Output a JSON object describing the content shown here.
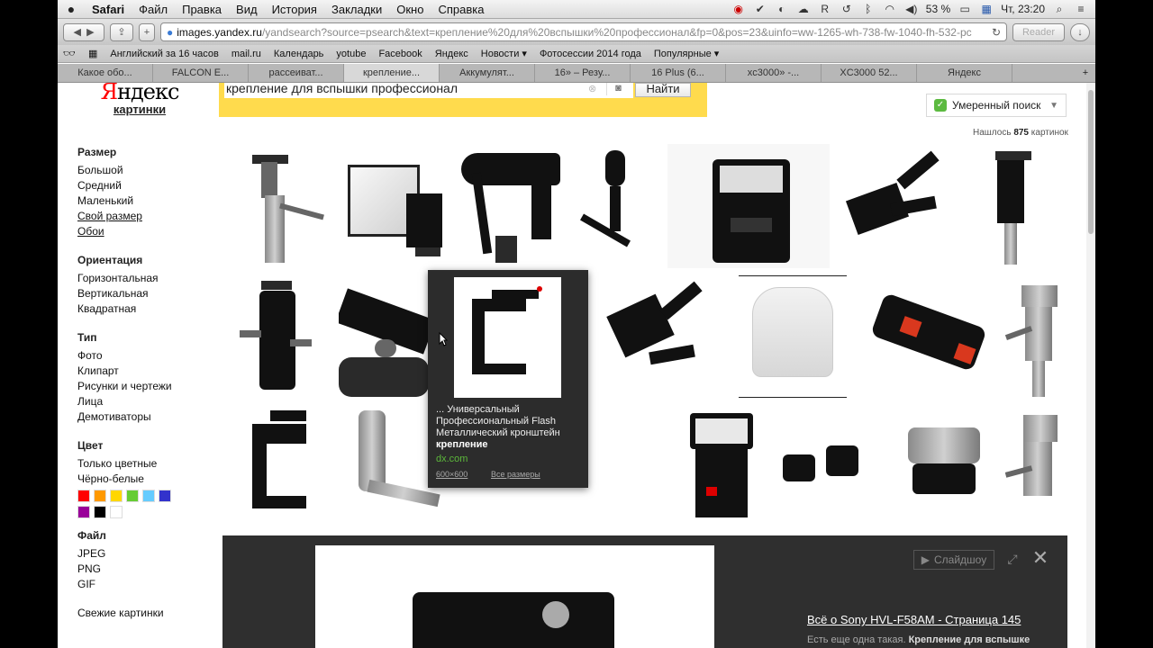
{
  "menubar": {
    "items": [
      "Safari",
      "Файл",
      "Правка",
      "Вид",
      "История",
      "Закладки",
      "Окно",
      "Справка"
    ],
    "battery": "53 %",
    "clock": "Чт, 23:20"
  },
  "toolbar": {
    "url_host": "images.yandex.ru",
    "url_rest": "/yandsearch?source=psearch&text=крепление%20для%20вспышки%20профессионал&fp=0&pos=23&uinfo=ww-1265-wh-738-fw-1040-fh-532-pc",
    "reader": "Reader"
  },
  "bookmarks": [
    "Английский за 16 часов",
    "mail.ru",
    "Календарь",
    "yotube",
    "Facebook",
    "Яндекс",
    "Новости ▾",
    "Фотосессии 2014 года",
    "Популярные ▾"
  ],
  "tabs": [
    "Какое обо...",
    "FALCON E...",
    "рассеиват...",
    "крепление...",
    "Аккумулят...",
    "16» – Резу...",
    "16 Plus (6...",
    "xc3000» -...",
    "XC3000 52...",
    "Яндекс"
  ],
  "header": {
    "logo": "Яндекс",
    "logo_first": "Я",
    "logo_rest": "ндекс",
    "logo_sub": "картинки",
    "search_value": "крепление для вспышки профессионал",
    "find_button": "Найти",
    "safe_search": "Умеренный поиск",
    "found_prefix": "Нашлось",
    "found_count": "875",
    "found_suffix": "картинок"
  },
  "sidebar": {
    "size": {
      "title": "Размер",
      "items": [
        "Большой",
        "Средний",
        "Маленький",
        "Свой размер",
        "Обои"
      ]
    },
    "orientation": {
      "title": "Ориентация",
      "items": [
        "Горизонтальная",
        "Вертикальная",
        "Квадратная"
      ]
    },
    "type": {
      "title": "Тип",
      "items": [
        "Фото",
        "Клипарт",
        "Рисунки и чертежи",
        "Лица",
        "Демотиваторы"
      ]
    },
    "color": {
      "title": "Цвет",
      "items": [
        "Только цветные",
        "Чёрно-белые"
      ],
      "swatches": [
        "#ff0000",
        "#ff9900",
        "#ffd700",
        "#66cc33",
        "#66ccff",
        "#3333cc",
        "#990099",
        "#000000",
        "#ffffff"
      ]
    },
    "file": {
      "title": "Файл",
      "items": [
        "JPEG",
        "PNG",
        "GIF"
      ]
    },
    "fresh": "Свежие картинки"
  },
  "popup": {
    "title_line1": "... Универсальный",
    "title_line2": "Профессиональный Flash",
    "title_line3": "Металлический кронштейн",
    "title_bold": "крепление",
    "source": "dx.com",
    "size": "600×600",
    "all_sizes": "Все размеры"
  },
  "preview": {
    "slideshow": "Слайдшоу",
    "title": "Всё о Sony HVL-F58AM - Страница 145",
    "desc_prefix": "Есть еще одна такая.",
    "desc_bold": "Крепление для вспышке"
  }
}
